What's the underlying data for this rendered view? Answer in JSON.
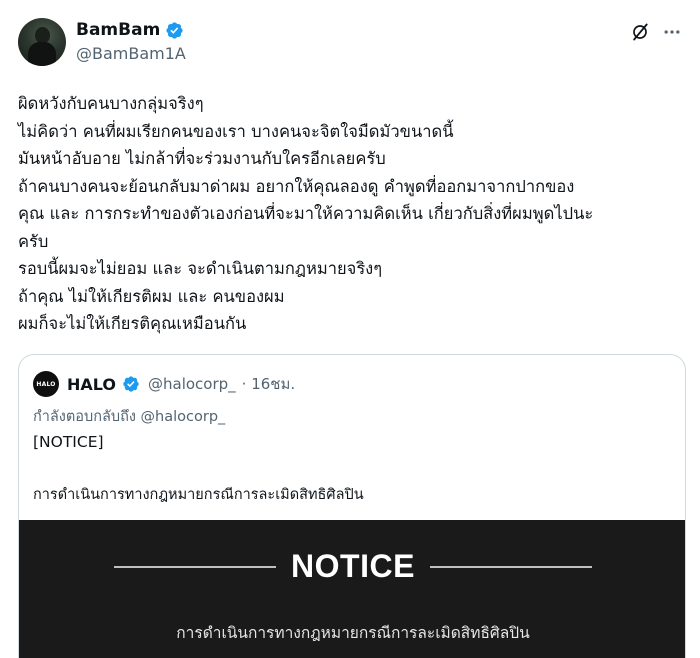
{
  "tweet": {
    "author": {
      "display_name": "BamBam",
      "handle": "@BamBam1A",
      "verified": true,
      "verified_color": "#1d9bf0"
    },
    "lines": [
      "ผิดหวังกับคนบางกลุ่มจริงๆ",
      "ไม่คิดว่า คนที่ผมเรียกคนของเรา บางคนจะจิตใจมืดมัวขนาดนี้",
      "มันหน้าอับอาย ไม่กล้าที่จะร่วมงานกับใครอีกเลยครับ",
      "ถ้าคนบางคนจะย้อนกลับมาด่าผม อยากให้คุณลองดู คำพูดที่ออกมาจากปากของ",
      "คุณ และ การกระทำของตัวเองก่อนที่จะมาให้ความคิดเห็น เกี่ยวกับสิ่งที่ผมพูดไปนะ",
      "ครับ",
      "รอบนี้ผมจะไม่ยอม และ จะดำเนินตามกฎหมายจริงๆ",
      "ถ้าคุณ ไม่ให้เกียรติผม และ คนของผม",
      "ผมก็จะไม่ให้เกียรติคุณเหมือนกัน"
    ]
  },
  "quote": {
    "avatar_text": "HALO",
    "display_name": "HALO",
    "handle": "@halocorp_",
    "time": "· 16ชม.",
    "reply_to": "กำลังตอบกลับถึง @halocorp_",
    "notice": "[NOTICE]",
    "description": "การดำเนินการทางกฎหมายกรณีการละเมิดสิทธิศิลปิน",
    "image": {
      "title": "NOTICE",
      "subtitle": "การดำเนินการทางกฎหมายกรณีการละเมิดสิทธิศิลปิน"
    }
  }
}
